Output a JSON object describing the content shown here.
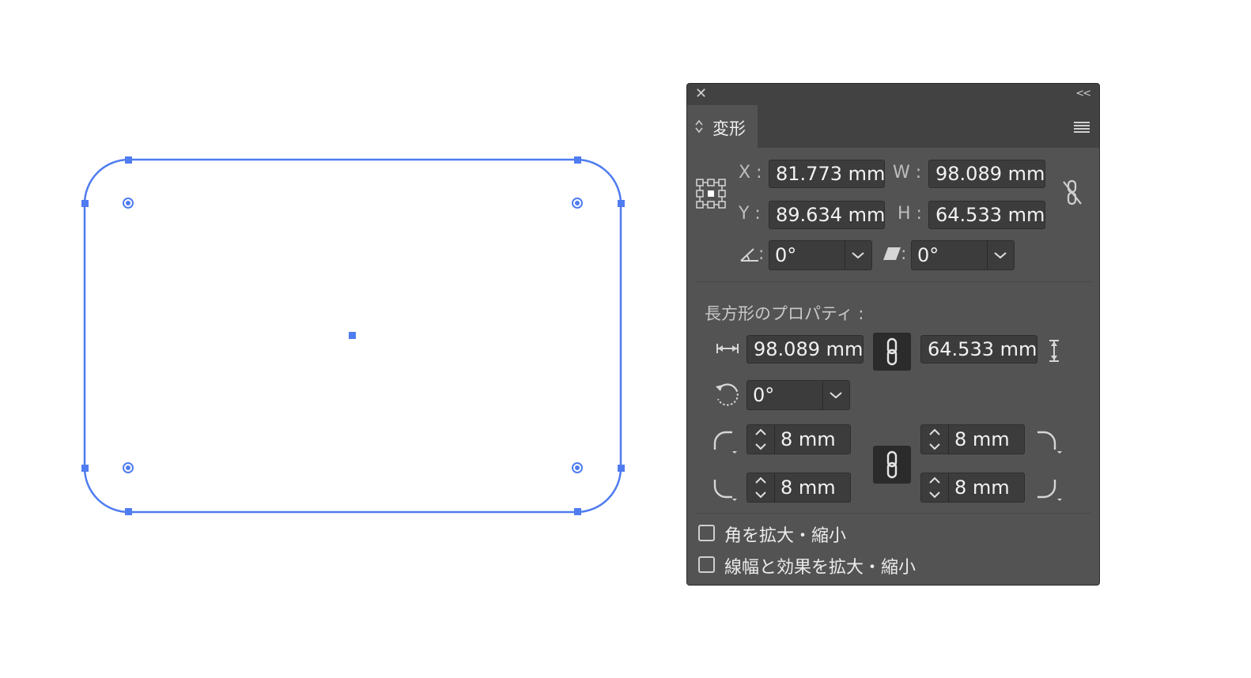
{
  "colors": {
    "selection": "#4f7cf0",
    "panel_bg": "#535353",
    "field_bg": "#3c3c3c"
  },
  "panel": {
    "close_icon": "close-icon",
    "collapse_label": "<<",
    "tab_label": "変形",
    "transform": {
      "x_label": "X :",
      "x_value": "81.773 mm",
      "y_label": "Y :",
      "y_value": "89.634 mm",
      "w_label": "W :",
      "w_value": "98.089 mm",
      "h_label": "H :",
      "h_value": "64.533 mm",
      "angle_colon": ":",
      "angle_value": "0°",
      "shear_colon": ":",
      "shear_value": "0°"
    },
    "rect_props": {
      "heading": "長方形のプロパティ :",
      "width_value": "98.089 mm",
      "height_value": "64.533 mm",
      "rotate_value": "0°",
      "corner_tl": "8 mm",
      "corner_tr": "8 mm",
      "corner_bl": "8 mm",
      "corner_br": "8 mm"
    },
    "options": {
      "scale_corners": "角を拡大・縮小",
      "scale_strokes": "線幅と効果を拡大・縮小"
    }
  }
}
